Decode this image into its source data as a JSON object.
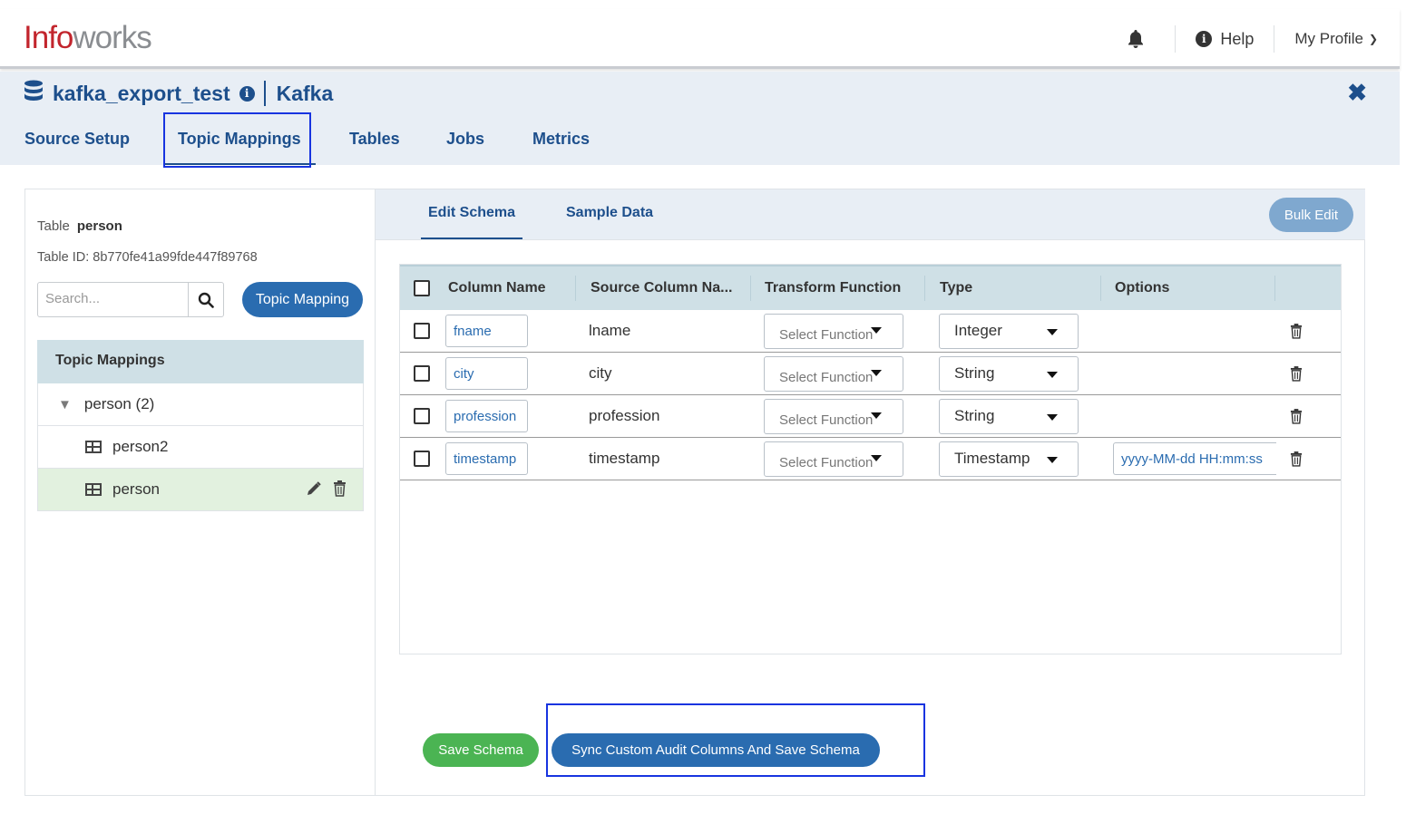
{
  "app": {
    "logo_part1": "Info",
    "logo_part2": "works",
    "help_label": "Help",
    "profile_label": "My Profile"
  },
  "source": {
    "name": "kafka_export_test",
    "type": "Kafka"
  },
  "nav_tabs": [
    {
      "label": "Source Setup"
    },
    {
      "label": "Topic Mappings",
      "active": true
    },
    {
      "label": "Tables"
    },
    {
      "label": "Jobs"
    },
    {
      "label": "Metrics"
    }
  ],
  "left": {
    "table_label": "Table",
    "table_name": "person",
    "table_id_text": "Table ID: 8b770fe41a99fde447f89768",
    "search_placeholder": "Search...",
    "topic_mapping_button": "Topic Mapping",
    "tree_header": "Topic Mappings",
    "tree": [
      {
        "label": "person (2)",
        "kind": "group"
      },
      {
        "label": "person2",
        "kind": "table"
      },
      {
        "label": "person",
        "kind": "table",
        "selected": true
      }
    ]
  },
  "subtabs": [
    {
      "label": "Edit Schema",
      "active": true
    },
    {
      "label": "Sample Data"
    }
  ],
  "bulk_edit_label": "Bulk Edit",
  "grid": {
    "headers": [
      "Column Name",
      "Source Column Na...",
      "Transform Function",
      "Type",
      "Options"
    ],
    "rows": [
      {
        "column": "fname",
        "source": "lname",
        "function": "Select Function",
        "type": "Integer",
        "options": ""
      },
      {
        "column": "city",
        "source": "city",
        "function": "Select Function",
        "type": "String",
        "options": ""
      },
      {
        "column": "profession",
        "source": "profession",
        "function": "Select Function",
        "type": "String",
        "options": ""
      },
      {
        "column": "timestamp",
        "source": "timestamp",
        "function": "Select Function",
        "type": "Timestamp",
        "options": "yyyy-MM-dd HH:mm:ss"
      }
    ]
  },
  "actions": {
    "save_label": "Save Schema",
    "sync_label": "Sync Custom Audit Columns And Save Schema"
  },
  "colors": {
    "primary_blue": "#1d4f8c",
    "button_blue": "#2a6cb0",
    "save_green": "#4bb453",
    "highlight_box": "#1834e0"
  }
}
